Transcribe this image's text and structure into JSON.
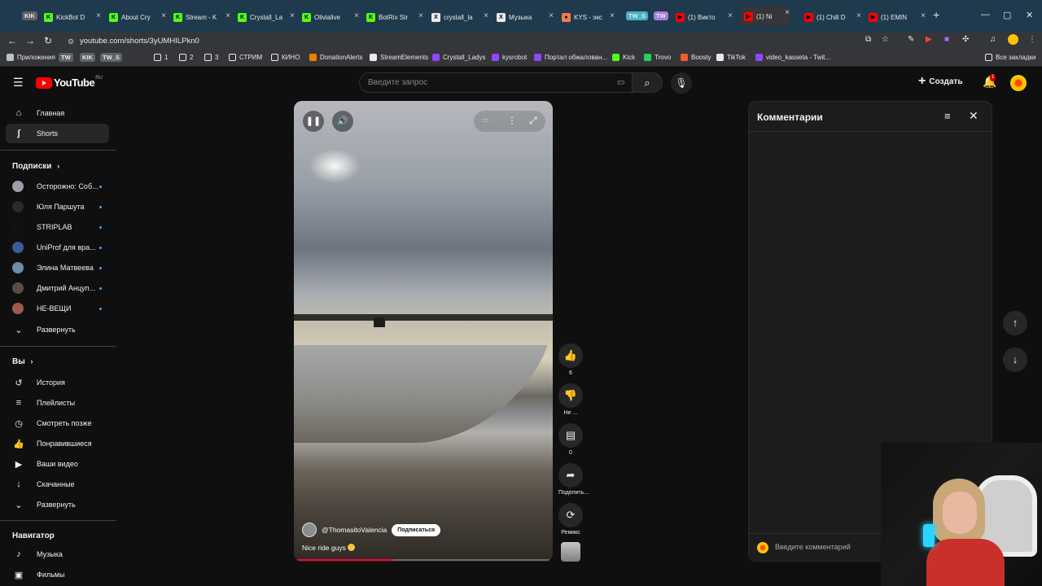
{
  "browser": {
    "tabs": [
      {
        "label": "KickBot D",
        "fav": "K",
        "color": "#53fc18"
      },
      {
        "label": "About Cry",
        "fav": "K",
        "color": "#53fc18"
      },
      {
        "label": "Stream - K",
        "fav": "K",
        "color": "#53fc18"
      },
      {
        "label": "Crystall_La",
        "fav": "K",
        "color": "#53fc18"
      },
      {
        "label": "Olivialive",
        "fav": "K",
        "color": "#53fc18"
      },
      {
        "label": "BotRix Str",
        "fav": "K",
        "color": "#53fc18"
      },
      {
        "label": "crystall_la",
        "fav": "X",
        "color": "#e8eaed"
      },
      {
        "label": "Музыка",
        "fav": "X",
        "color": "#e8eaed"
      },
      {
        "label": "KYS - экс",
        "fav": "●",
        "color": "#f07c4a"
      },
      {
        "label": "(1) Викто",
        "fav": "▶",
        "color": "#ff0000"
      },
      {
        "label": "(1) Ni",
        "fav": "▶",
        "color": "#ff0000"
      },
      {
        "label": "(1) Chill D",
        "fav": "▶",
        "color": "#ff0000"
      },
      {
        "label": "(1) EMIN",
        "fav": "▶",
        "color": "#ff0000"
      }
    ],
    "tab_badges": {
      "kik": "KIK",
      "tws": "TW_S",
      "tw": "TW"
    },
    "url": "youtube.com/shorts/3yUMHILPkn0",
    "bookmarks": [
      {
        "label": "Приложения"
      },
      {
        "label": "TW",
        "badge": true
      },
      {
        "label": "KIK",
        "badge": true
      },
      {
        "label": "TW_S",
        "badge": true
      },
      {
        "label": "1"
      },
      {
        "label": "2"
      },
      {
        "label": "3"
      },
      {
        "label": "СТРИМ"
      },
      {
        "label": "КИНО"
      },
      {
        "label": "DonationAlerts"
      },
      {
        "label": "StreamElements"
      },
      {
        "label": "Crystall_Ladys"
      },
      {
        "label": "kysrobot"
      },
      {
        "label": "Портал обжалован..."
      },
      {
        "label": "Kick"
      },
      {
        "label": "Trovo"
      },
      {
        "label": "Boosty"
      },
      {
        "label": "TikTok"
      },
      {
        "label": "video_kasseta - Twit..."
      }
    ],
    "all_bookmarks": "Все закладки"
  },
  "youtube": {
    "logo_text": "YouTube",
    "logo_region": "RU",
    "search_placeholder": "Введите запрос",
    "create_label": "Создать",
    "bell_count": "1"
  },
  "sidebar": {
    "main": [
      {
        "label": "Главная",
        "icon": "home-icon",
        "glyph": "⌂"
      },
      {
        "label": "Shorts",
        "icon": "shorts-icon",
        "glyph": "ʃ"
      }
    ],
    "subs_title": "Подписки",
    "subs": [
      {
        "label": "Осторожно: Соб...",
        "color": "#9aa0a6"
      },
      {
        "label": "Юля Паршута",
        "color": "#2a2a2a"
      },
      {
        "label": "STRIPLAB",
        "color": "#111111"
      },
      {
        "label": "UniProf для вра...",
        "color": "#3d5a98"
      },
      {
        "label": "Элина Матвеева",
        "color": "#6b8fa8"
      },
      {
        "label": "Дмитрий Анцуп...",
        "color": "#5b4d46"
      },
      {
        "label": "НЕ-ВЕЩИ",
        "color": "#a05a4a"
      }
    ],
    "expand_label": "Развернуть",
    "you_title": "Вы",
    "you": [
      {
        "label": "История",
        "icon": "history-icon",
        "glyph": "↺"
      },
      {
        "label": "Плейлисты",
        "icon": "playlists-icon",
        "glyph": "≡"
      },
      {
        "label": "Смотреть позже",
        "icon": "watch-later-icon",
        "glyph": "◷"
      },
      {
        "label": "Понравившиеся",
        "icon": "like-icon",
        "glyph": "👍"
      },
      {
        "label": "Ваши видео",
        "icon": "your-videos-icon",
        "glyph": "▶"
      },
      {
        "label": "Скачанные",
        "icon": "download-icon",
        "glyph": "↓"
      }
    ],
    "expand2_label": "Развернуть",
    "nav_title": "Навигатор",
    "nav": [
      {
        "label": "Музыка",
        "icon": "music-icon",
        "glyph": "♪"
      },
      {
        "label": "Фильмы",
        "icon": "movies-icon",
        "glyph": "▣"
      }
    ]
  },
  "short": {
    "channel": "@ThomasitoValencia",
    "subscribe_label": "Подписаться",
    "caption": "Nice ride guys",
    "progress": 0.38
  },
  "actions": {
    "like_count": "6",
    "dislike_label": "Не ...",
    "comments_count": "0",
    "share_label": "Поделить...",
    "remix_label": "Ремикс"
  },
  "comments": {
    "title": "Комментарии",
    "input_placeholder": "Введите комментарий"
  }
}
